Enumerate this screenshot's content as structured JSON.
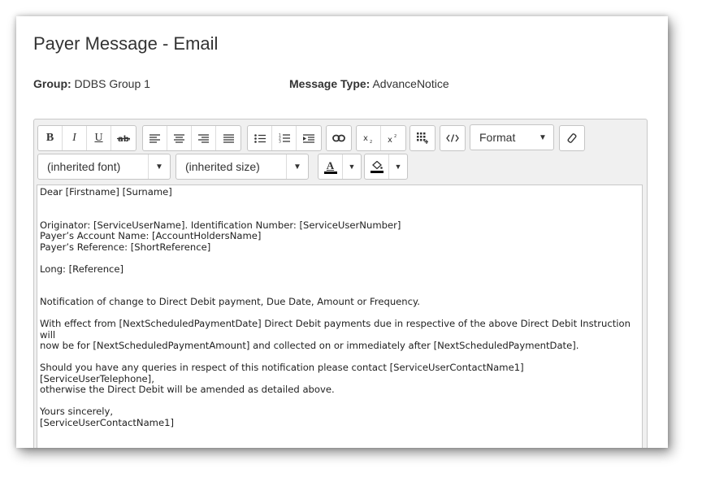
{
  "page": {
    "title": "Payer Message - Email",
    "group_label": "Group:",
    "group_value": "DDBS Group 1",
    "type_label": "Message Type:",
    "type_value": "AdvanceNotice"
  },
  "toolbar": {
    "bold": "B",
    "italic": "I",
    "underline": "U",
    "format_label": "Format",
    "font_label": "(inherited font)",
    "size_label": "(inherited size)",
    "text_color_glyph": "A",
    "caret": "▼"
  },
  "content": {
    "lines": [
      "Dear [Firstname] [Surname]",
      "",
      "",
      "Originator: [ServiceUserName]. Identification Number: [ServiceUserNumber]",
      "Payer’s Account Name: [AccountHoldersName]",
      "Payer’s Reference: [ShortReference]",
      "",
      "Long: [Reference]",
      "",
      "",
      "Notification of change to Direct Debit payment, Due Date, Amount or Frequency.",
      "",
      "With effect from [NextScheduledPaymentDate] Direct Debit payments due in respective of the above Direct Debit Instruction will",
      "now be for [NextScheduledPaymentAmount] and collected on or immediately after [NextScheduledPaymentDate].",
      "",
      "Should you have any queries in respect of this notification please contact [ServiceUserContactName1] [ServiceUserTelephone],",
      "otherwise the Direct Debit will be amended as detailed above.",
      "",
      "Yours sincerely,",
      "[ServiceUserContactName1]"
    ]
  },
  "colors": {
    "text_color_bar": "#000000",
    "highlight_color_bar": "#000000"
  }
}
